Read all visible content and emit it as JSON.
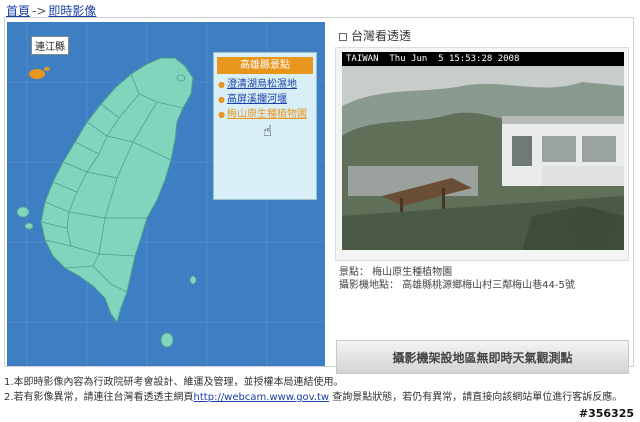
{
  "breadcrumb": {
    "home": "首頁",
    "separator": "->",
    "current": "即時影像"
  },
  "map": {
    "island_label": "連江縣",
    "panel_title": "高雄縣景點",
    "spots": [
      {
        "label": "澄清湖烏松濕地"
      },
      {
        "label": "高屏溪攔河堰"
      },
      {
        "label": "梅山原生種植物園"
      }
    ],
    "colors": {
      "sea": "#3e7ec2",
      "land": "#7fd6bd",
      "accent": "#e8961e"
    }
  },
  "camera": {
    "section_title": "台灣看透透",
    "stamp": "TAIWAN  Thu Jun  5 15:53:28 2008",
    "spot_line": "景點： 梅山原生種植物園",
    "location_line": "攝影機地點： 高雄縣桃源鄉梅山村三鄰梅山巷44-5號",
    "no_weather": "攝影機架設地區無即時天氣觀測點"
  },
  "notes": {
    "line1": "1.本即時影像內容為行政院研考會設計、維運及管理，並授權本局連結使用。",
    "line2_prefix": "2.若有影像異常，請連往台灣看透透主網頁",
    "line2_link": "http://webcam.www.gov.tw",
    "line2_suffix": " 查詢景點狀態，若仍有異常，請直接向該網站單位進行客訴反應。"
  },
  "serial": "#356325"
}
